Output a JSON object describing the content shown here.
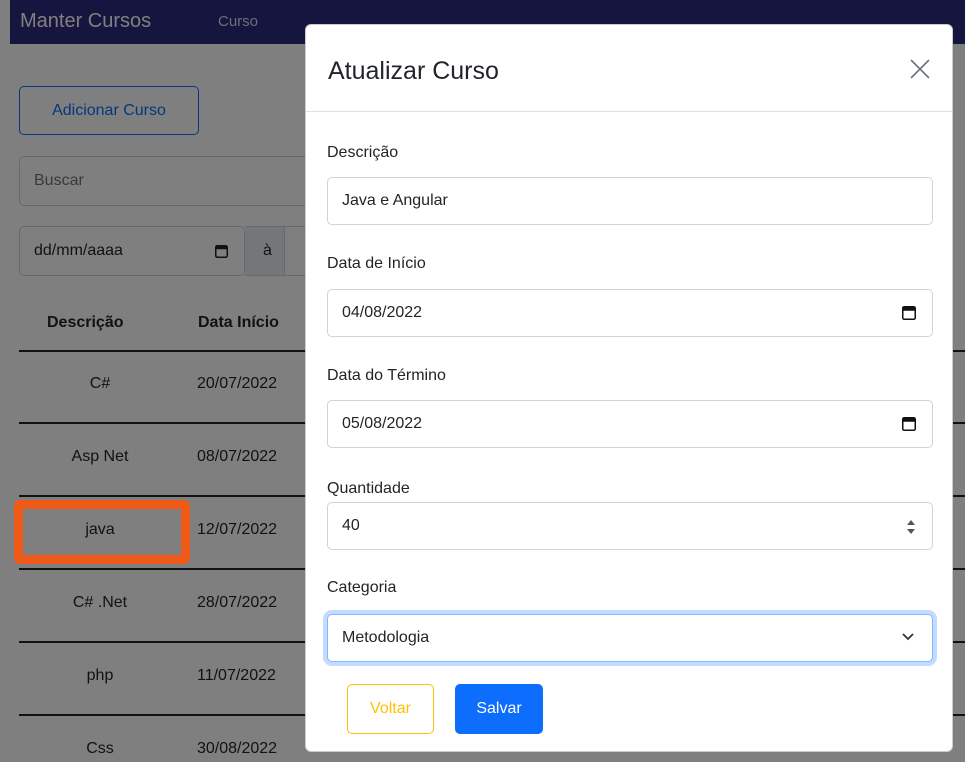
{
  "navbar": {
    "brand": "Manter Cursos",
    "link": "Curso"
  },
  "page": {
    "add_button": "Adicionar Curso",
    "search_placeholder": "Buscar",
    "date_start_placeholder": "dd/mm/aaaa",
    "date_separator": "à",
    "table_headers": {
      "description": "Descrição",
      "start_date": "Data Início"
    },
    "rows": [
      {
        "description": "C#",
        "start_date": "20/07/2022"
      },
      {
        "description": "Asp Net",
        "start_date": "08/07/2022"
      },
      {
        "description": "java",
        "start_date": "12/07/2022"
      },
      {
        "description": "C# .Net",
        "start_date": "28/07/2022"
      },
      {
        "description": "php",
        "start_date": "11/07/2022"
      },
      {
        "description": "Css",
        "start_date": "30/08/2022"
      }
    ]
  },
  "modal": {
    "title": "Atualizar Curso",
    "description_label": "Descrição",
    "description_value": "Java e Angular",
    "start_label": "Data de Início",
    "start_value": "04/08/2022",
    "end_label": "Data do Término",
    "end_value": "05/08/2022",
    "quantity_label": "Quantidade",
    "quantity_value": "40",
    "category_label": "Categoria",
    "category_value": "Metodologia",
    "back_button": "Voltar",
    "save_button": "Salvar"
  },
  "colors": {
    "navbar": "#2a2a7e",
    "primary": "#0d6efd",
    "warning": "#ffc107",
    "highlight": "#f05a19"
  },
  "icons": [
    "calendar-icon",
    "close-icon",
    "chevron-down-icon",
    "spinner-arrows-icon"
  ]
}
